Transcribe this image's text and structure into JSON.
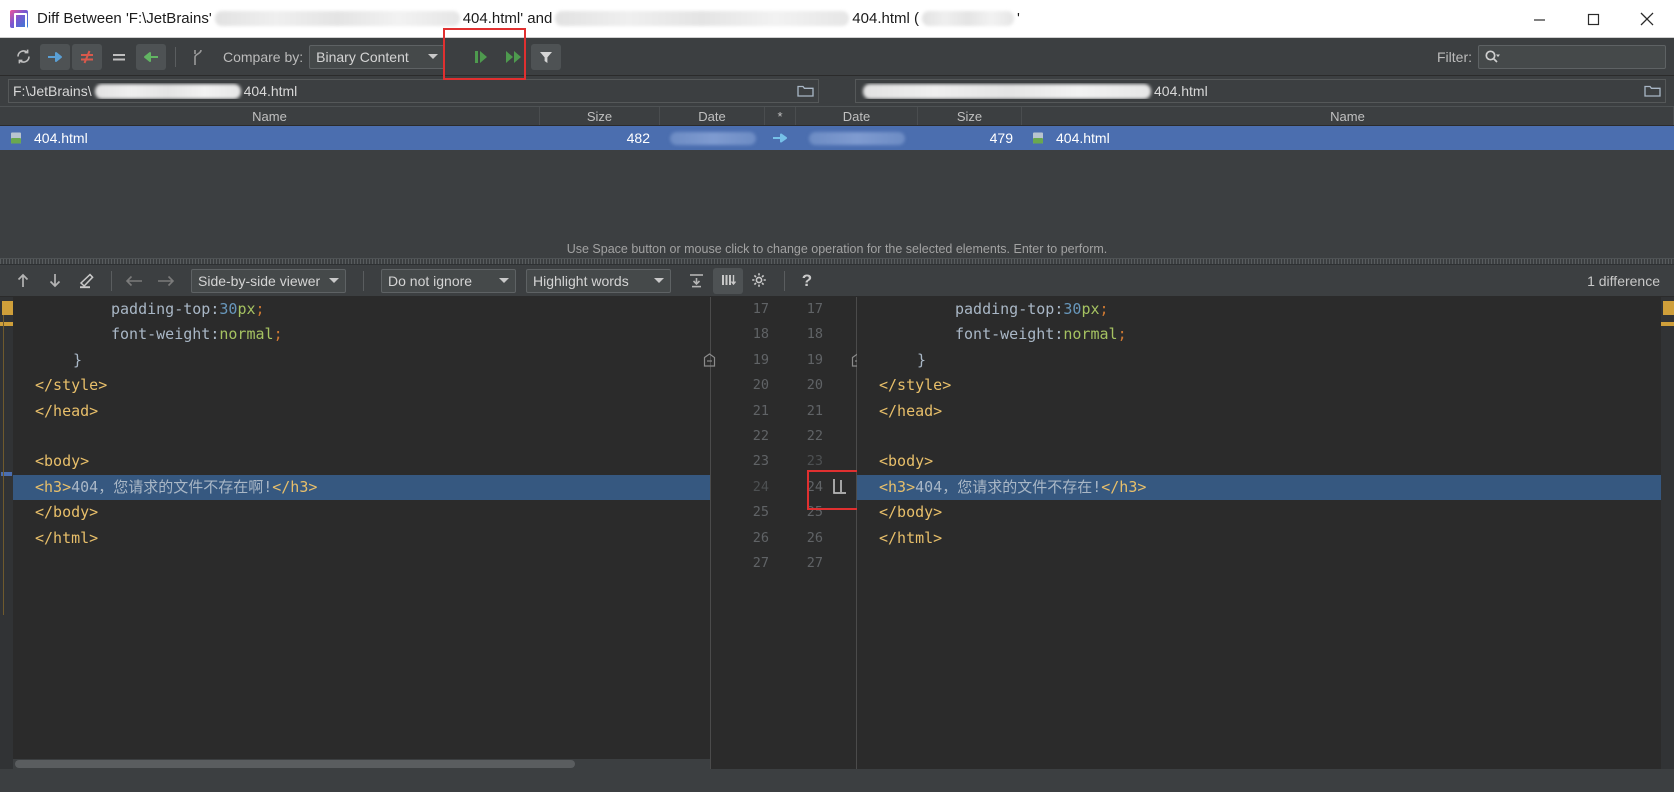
{
  "window": {
    "title_prefix": "Diff Between 'F:\\JetBrains'",
    "title_file_1": "404.html' and",
    "title_file_2": "404.html (",
    "title_suffix": "'",
    "app_icon": "jetbrains-icon",
    "minimize": "minimize-icon",
    "maximize": "maximize-icon",
    "close": "close-icon"
  },
  "toolbar": {
    "refresh": "refresh-icon",
    "copy_right": "copy-to-right-icon",
    "show_difference": "not-equal-icon",
    "show_equal": "equal-icon",
    "copy_left": "copy-to-left-icon",
    "merge": "merge-icon",
    "compare_by_label": "Compare by:",
    "compare_by_value": "Binary Content",
    "synchronize": "synchronize-icon",
    "synchronize_all": "fast-forward-icon",
    "filter_funnel": "funnel-icon",
    "filter_label": "Filter:",
    "filter_value": "",
    "filter_placeholder": "",
    "search_icon": "search-icon"
  },
  "paths": {
    "left": {
      "prefix": "F:\\JetBrains\\",
      "file": "404.html",
      "browse": "folder-icon"
    },
    "right": {
      "prefix": "",
      "file": "404.html",
      "browse": "folder-icon"
    }
  },
  "table": {
    "columns": [
      "Name",
      "Size",
      "Date",
      "*",
      "Date",
      "Size",
      "Name"
    ],
    "rows": [
      {
        "left_icon": "html-file-icon",
        "left_name": "404.html",
        "left_size": "482",
        "left_date": "",
        "operation": "copy-right-arrow-icon",
        "right_date": "",
        "right_size": "479",
        "right_icon": "html-file-icon",
        "right_name": "404.html",
        "selected": true
      }
    ],
    "hint": "Use Space button or mouse click to change operation for the selected elements. Enter to perform."
  },
  "diff_toolbar": {
    "prev_difference": "arrow-up-icon",
    "next_difference": "arrow-down-icon",
    "edit": "pencil-icon",
    "accept_left": "arrow-left-icon",
    "accept_right": "arrow-right-icon",
    "viewer_mode": "Side-by-side viewer",
    "ignore_policy": "Do not ignore",
    "highlight_mode": "Highlight words",
    "collapse_unchanged": "collapse-lines-icon",
    "whitespace_toggle": "show-whitespace-icon",
    "settings": "gear-icon",
    "help": "help-icon",
    "difference_count": "1 difference"
  },
  "editor": {
    "left_lines": [
      {
        "indent": 8,
        "tokens": [
          {
            "t": "padding-top",
            "c": "txtw"
          },
          {
            "t": ":",
            "c": "punct"
          },
          {
            "t": "30",
            "c": "num"
          },
          {
            "t": "px",
            "c": "val"
          },
          {
            "t": ";",
            "c": "semi"
          }
        ]
      },
      {
        "indent": 8,
        "tokens": [
          {
            "t": "font-weight",
            "c": "txtw"
          },
          {
            "t": ":",
            "c": "punct"
          },
          {
            "t": "normal",
            "c": "val"
          },
          {
            "t": ";",
            "c": "semi"
          }
        ]
      },
      {
        "indent": 4,
        "tokens": [
          {
            "t": "}",
            "c": "txtw"
          }
        ]
      },
      {
        "indent": 0,
        "tokens": [
          {
            "t": "</style>",
            "c": "tag"
          }
        ]
      },
      {
        "indent": 0,
        "tokens": [
          {
            "t": "</head>",
            "c": "tag"
          }
        ]
      },
      {
        "indent": 0,
        "tokens": []
      },
      {
        "indent": 0,
        "tokens": [
          {
            "t": "<body>",
            "c": "tag"
          }
        ]
      },
      {
        "indent": 0,
        "highlight": true,
        "tokens": [
          {
            "t": "<h3>",
            "c": "tag"
          },
          {
            "t": "404，您请求的文件不存在啊!",
            "c": "txtw"
          },
          {
            "t": "</h3>",
            "c": "tag"
          }
        ]
      },
      {
        "indent": 0,
        "tokens": [
          {
            "t": "</body>",
            "c": "tag"
          }
        ]
      },
      {
        "indent": 0,
        "tokens": [
          {
            "t": "</html>",
            "c": "tag"
          }
        ]
      }
    ],
    "right_lines": [
      {
        "indent": 8,
        "tokens": [
          {
            "t": "padding-top",
            "c": "txtw"
          },
          {
            "t": ":",
            "c": "punct"
          },
          {
            "t": "30",
            "c": "num"
          },
          {
            "t": "px",
            "c": "val"
          },
          {
            "t": ";",
            "c": "semi"
          }
        ]
      },
      {
        "indent": 8,
        "tokens": [
          {
            "t": "font-weight",
            "c": "txtw"
          },
          {
            "t": ":",
            "c": "punct"
          },
          {
            "t": "normal",
            "c": "val"
          },
          {
            "t": ";",
            "c": "semi"
          }
        ]
      },
      {
        "indent": 4,
        "tokens": [
          {
            "t": "}",
            "c": "txtw"
          }
        ]
      },
      {
        "indent": 0,
        "tokens": [
          {
            "t": "</style>",
            "c": "tag"
          }
        ]
      },
      {
        "indent": 0,
        "tokens": [
          {
            "t": "</head>",
            "c": "tag"
          }
        ]
      },
      {
        "indent": 0,
        "tokens": []
      },
      {
        "indent": 0,
        "tokens": [
          {
            "t": "<body>",
            "c": "tag"
          }
        ]
      },
      {
        "indent": 0,
        "highlight": true,
        "tokens": [
          {
            "t": "<h3>",
            "c": "tag"
          },
          {
            "t": "404，您请求的文件不存在!",
            "c": "txtw"
          },
          {
            "t": "</h3>",
            "c": "tag"
          }
        ]
      },
      {
        "indent": 0,
        "tokens": [
          {
            "t": "</body>",
            "c": "tag"
          }
        ]
      },
      {
        "indent": 0,
        "tokens": [
          {
            "t": "</html>",
            "c": "tag"
          }
        ]
      }
    ],
    "left_line_numbers": [
      "17",
      "18",
      "19",
      "20",
      "21",
      "22",
      "23",
      "24",
      "25",
      "26",
      "27"
    ],
    "right_line_numbers": [
      "17",
      "18",
      "19",
      "20",
      "21",
      "22",
      "23",
      "24",
      "25",
      "26",
      "27"
    ],
    "left_dim_flags": [
      false,
      false,
      false,
      false,
      false,
      false,
      false,
      true,
      false,
      false,
      false
    ],
    "right_dim_flags": [
      false,
      false,
      false,
      false,
      false,
      false,
      true,
      false,
      false,
      false,
      false
    ],
    "apply_change_icon": "apply-change-icon"
  },
  "colors": {
    "accent_selection": "#4b6eaf",
    "diff_highlight": "#365880",
    "annotation_red": "#e03030",
    "editor_bg": "#2b2b2b",
    "chrome_bg": "#3c3f41"
  }
}
